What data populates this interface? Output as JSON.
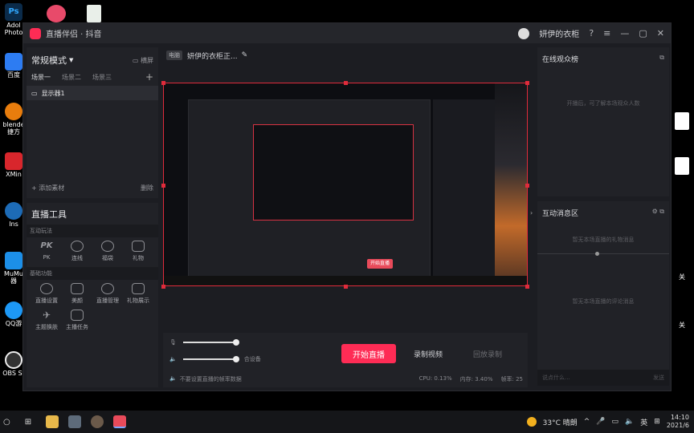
{
  "desktop": {
    "icons_left": [
      {
        "label": "Adol Photo",
        "icon": "photoshop-icon",
        "color": "#0b2b4a"
      },
      {
        "label": "百度",
        "icon": "baidu-icon",
        "color": "#2d7cf2"
      },
      {
        "label": "blende 捷方",
        "icon": "blender-icon",
        "color": "#e87d0d"
      },
      {
        "label": "XMin",
        "icon": "xmind-icon",
        "color": "#d8262c"
      },
      {
        "label": "Ins",
        "icon": "globe-icon",
        "color": "#1d6bb6"
      },
      {
        "label": "MuMu 器",
        "icon": "mumu-icon",
        "color": "#1c8fe8"
      },
      {
        "label": "QQ游",
        "icon": "qq-game-icon",
        "color": "#1d98f5"
      },
      {
        "label": "OBS St",
        "icon": "obs-icon",
        "color": "#333333"
      }
    ],
    "right_labels": [
      "关",
      "关",
      "关"
    ]
  },
  "window": {
    "app_title": "直播伴侣 · 抖音",
    "user_name": "妍伊的衣柜",
    "buttons": {
      "help": "?",
      "minimize": "—",
      "maximize": "▢",
      "close": "✕"
    }
  },
  "scene": {
    "mode": "常规模式",
    "landscape_label": "横屏",
    "tabs": [
      "场景一",
      "场景二",
      "场景三"
    ],
    "sources": [
      "显示器1"
    ],
    "add_material": "添加素材",
    "delete_label": "删除"
  },
  "tools": {
    "title": "直播工具",
    "section_interactive": "互动玩法",
    "interactive": [
      "PK",
      "连线",
      "福袋",
      "礼物"
    ],
    "section_basic": "基础功能",
    "basic": [
      "直播设置",
      "美颜",
      "直播管理",
      "礼物展示",
      "主题换肤",
      "主播任务"
    ]
  },
  "center": {
    "room_badge": "电脑",
    "room_title": "妍伊的衣柜正...",
    "mini_live": "开始直播",
    "go_live": "开始直播",
    "record": "录制视频",
    "replay": "回放录制",
    "mixer_label": "合设备",
    "hint": "不要设置直播的帧率数据",
    "cpu": "CPU: 0.13%",
    "mem": "内存: 3.40%",
    "fps": "帧率: 25"
  },
  "right": {
    "audience_title": "在线观众榜",
    "audience_empty": "开播后，可了解本场观众人数",
    "interact_title": "互动消息区",
    "interact_empty_1": "暂无本场直播的礼物消息",
    "interact_empty_2": "暂无本场直播的评论消息",
    "send_placeholder": "说点什么...",
    "send": "发送"
  },
  "taskbar": {
    "weather": "33°C 晴朗",
    "ime": "英",
    "time": "14:10",
    "date": "2021/6"
  }
}
